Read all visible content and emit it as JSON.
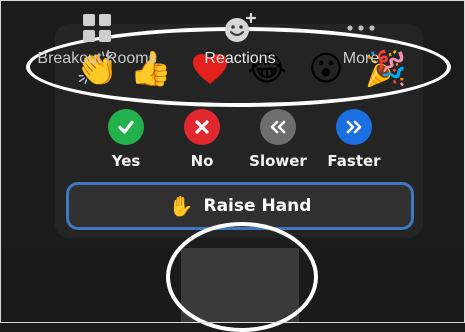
{
  "reactions": {
    "emojis": [
      {
        "icon": "clapping-hands-icon",
        "glyph": "👏"
      },
      {
        "icon": "thumbs-up-icon",
        "glyph": "👍"
      },
      {
        "icon": "heart-icon",
        "glyph": "❤"
      },
      {
        "icon": "tears-of-joy-icon",
        "glyph": "😂"
      },
      {
        "icon": "open-mouth-icon",
        "glyph": "😮"
      },
      {
        "icon": "party-popper-icon",
        "glyph": "🎉"
      }
    ],
    "responses": [
      {
        "label": "Yes",
        "icon": "check-icon",
        "color": "#22b14c"
      },
      {
        "label": "No",
        "icon": "x-icon",
        "color": "#e0282e"
      },
      {
        "label": "Slower",
        "icon": "chevrons-left-icon",
        "color": "#6e6e6e"
      },
      {
        "label": "Faster",
        "icon": "chevrons-right-icon",
        "color": "#1b6fe0"
      }
    ],
    "raise_hand": {
      "label": "Raise Hand",
      "icon": "raised-hand-icon"
    }
  },
  "toolbar": {
    "items": [
      {
        "label": "Breakout Rooms",
        "icon": "breakout-rooms-icon"
      },
      {
        "label": "Reactions",
        "icon": "add-reaction-icon",
        "active": true
      },
      {
        "label": "More",
        "icon": "more-dots-icon"
      }
    ]
  },
  "colors": {
    "accent": "#3f78c0",
    "annotation": "#ffffff"
  }
}
